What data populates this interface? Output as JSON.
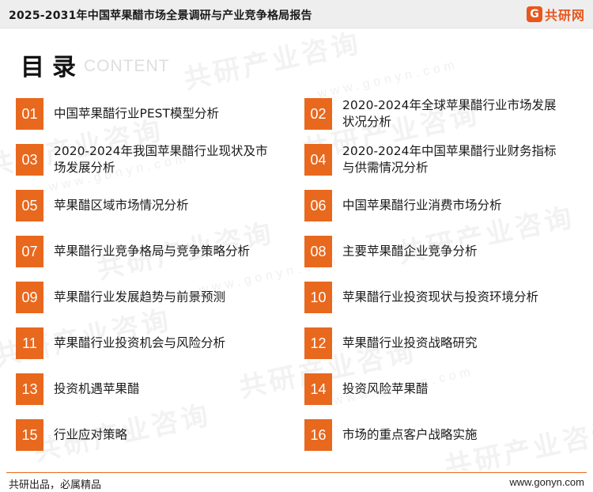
{
  "header": {
    "title": "2025-2031年中国苹果醋市场全景调研与产业竞争格局报告",
    "brand": {
      "icon_char": "G",
      "name": "共研网",
      "color": "#e8571c"
    }
  },
  "toc": {
    "heading": "目录",
    "subheading": "CONTENT",
    "accent_color": "#e8681e",
    "items": [
      {
        "num": "01",
        "label": "中国苹果醋行业PEST模型分析"
      },
      {
        "num": "02",
        "label": "2020-2024年全球苹果醋行业市场发展状况分析"
      },
      {
        "num": "03",
        "label": "2020-2024年我国苹果醋行业现状及市场发展分析"
      },
      {
        "num": "04",
        "label": "2020-2024年中国苹果醋行业财务指标与供需情况分析"
      },
      {
        "num": "05",
        "label": "苹果醋区域市场情况分析"
      },
      {
        "num": "06",
        "label": "中国苹果醋行业消费市场分析"
      },
      {
        "num": "07",
        "label": "苹果醋行业竞争格局与竞争策略分析"
      },
      {
        "num": "08",
        "label": "主要苹果醋企业竞争分析"
      },
      {
        "num": "09",
        "label": "苹果醋行业发展趋势与前景预测"
      },
      {
        "num": "10",
        "label": "苹果醋行业投资现状与投资环境分析"
      },
      {
        "num": "11",
        "label": "苹果醋行业投资机会与风险分析"
      },
      {
        "num": "12",
        "label": "苹果醋行业投资战略研究"
      },
      {
        "num": "13",
        "label": "投资机遇苹果醋"
      },
      {
        "num": "14",
        "label": "投资风险苹果醋"
      },
      {
        "num": "15",
        "label": "行业应对策略"
      },
      {
        "num": "16",
        "label": "市场的重点客户战略实施"
      }
    ]
  },
  "watermark": {
    "text": "共研产业咨询",
    "url": "www.gonyn.com"
  },
  "footer": {
    "slogan": "共研出品，必属精品",
    "url": "www.gonyn.com"
  }
}
